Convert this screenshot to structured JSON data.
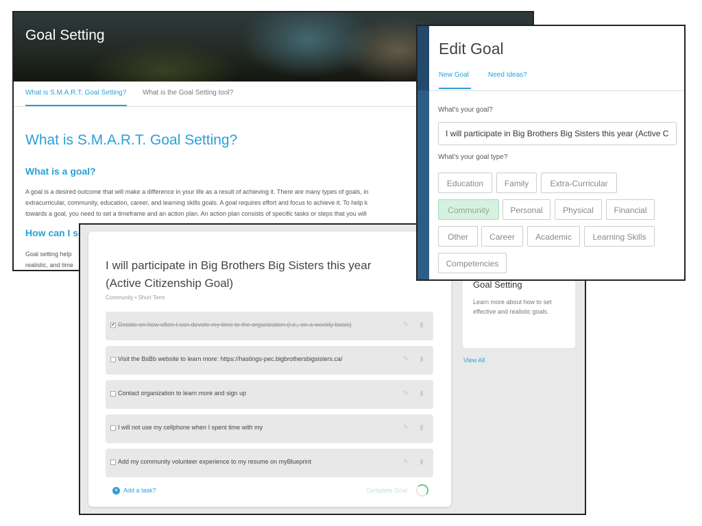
{
  "goal_setting_window": {
    "title": "Goal Setting",
    "tabs": [
      "What is S.M.A.R.T. Goal Setting?",
      "What is the Goal Setting tool?"
    ],
    "heading": "What is S.M.A.R.T. Goal Setting?",
    "subheading": "What is a goal?",
    "paragraph_lines": [
      "A goal is a desired outcome that will make a difference in your life as a result of achieving it. There are many types of goals, in",
      "extracurricular, community, education, career, and learning skills goals. A goal requires effort and focus to achieve it. To help k",
      "towards a goal, you need to set a timeframe and an action plan. An action plan consists of specific tasks or steps that you will"
    ],
    "subheading2": "How can I se",
    "paragraph2_lines": [
      "Goal setting help",
      "realistic, and time"
    ]
  },
  "goal_detail_window": {
    "goal_title": "I will participate in Big Brothers Big Sisters this year (Active Citizenship Goal)",
    "goal_meta": "Community • Short Term",
    "tasks": [
      {
        "text": "Decide on how often I can devote my time to the organization (i.e., on a weekly basis)",
        "completed": true
      },
      {
        "text": "Visit the BsBb website to learn more: https://hastings-pec.bigbrothersbigsisters.ca/",
        "completed": false
      },
      {
        "text": "Contact organization to learn more and sign up",
        "completed": false
      },
      {
        "text": "I will not use my cellphone when I spent time with my",
        "completed": false
      },
      {
        "text": "Add my community volunteer experience to my resume on myBlueprint",
        "completed": false
      }
    ],
    "add_task_label": "Add a task?",
    "complete_goal_label": "Complete Goal",
    "side_card": {
      "title": "Goal Setting",
      "description": "Learn more about how to set effective and realistic goals."
    },
    "view_all_label": "View All"
  },
  "edit_goal_window": {
    "title": "Edit Goal",
    "tabs": [
      "New Goal",
      "Need Ideas?"
    ],
    "active_tab": "New Goal",
    "goal_question": "What's your goal?",
    "goal_value": "I will participate in Big Brothers Big Sisters this year (Active Citizenship Goal)",
    "type_question": "What's your goal type?",
    "goal_types": [
      "Education",
      "Family",
      "Extra-Curricular",
      "Community",
      "Personal",
      "Physical",
      "Financial",
      "Other",
      "Career",
      "Academic",
      "Learning Skills",
      "Competencies"
    ],
    "selected_type": "Community"
  },
  "icons": {
    "edit": "pencil-icon",
    "delete": "trash-icon",
    "add": "plus-circle-icon",
    "progress": "progress-ring-icon",
    "checkbox": "checkbox-icon"
  },
  "colors": {
    "accent": "#2a9fd6",
    "selected_chip_bg": "#d5f1df",
    "sidebar_strip": "#2d5d85"
  }
}
